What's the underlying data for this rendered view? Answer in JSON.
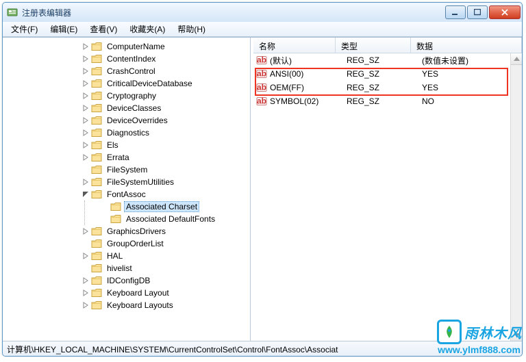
{
  "window": {
    "title": "注册表编辑器"
  },
  "menu": {
    "file": "文件(F)",
    "edit": "编辑(E)",
    "view": "查看(V)",
    "favorites": "收藏夹(A)",
    "help": "帮助(H)"
  },
  "tree": {
    "items": [
      {
        "label": "ComputerName",
        "expandable": true
      },
      {
        "label": "ContentIndex",
        "expandable": true
      },
      {
        "label": "CrashControl",
        "expandable": true
      },
      {
        "label": "CriticalDeviceDatabase",
        "expandable": true
      },
      {
        "label": "Cryptography",
        "expandable": true
      },
      {
        "label": "DeviceClasses",
        "expandable": true
      },
      {
        "label": "DeviceOverrides",
        "expandable": true
      },
      {
        "label": "Diagnostics",
        "expandable": true
      },
      {
        "label": "Els",
        "expandable": true
      },
      {
        "label": "Errata",
        "expandable": true
      },
      {
        "label": "FileSystem",
        "expandable": false
      },
      {
        "label": "FileSystemUtilities",
        "expandable": true
      },
      {
        "label": "FontAssoc",
        "expandable": true,
        "expanded": true,
        "children": [
          {
            "label": "Associated Charset",
            "expandable": false,
            "selected": true
          },
          {
            "label": "Associated DefaultFonts",
            "expandable": false
          }
        ]
      },
      {
        "label": "GraphicsDrivers",
        "expandable": true
      },
      {
        "label": "GroupOrderList",
        "expandable": false
      },
      {
        "label": "HAL",
        "expandable": true
      },
      {
        "label": "hivelist",
        "expandable": false
      },
      {
        "label": "IDConfigDB",
        "expandable": true
      },
      {
        "label": "Keyboard Layout",
        "expandable": true
      },
      {
        "label": "Keyboard Layouts",
        "expandable": true
      }
    ]
  },
  "list": {
    "headers": {
      "name": "名称",
      "type": "类型",
      "data": "数据"
    },
    "rows": [
      {
        "name": "(默认)",
        "type": "REG_SZ",
        "data": "(数值未设置)"
      },
      {
        "name": "ANSI(00)",
        "type": "REG_SZ",
        "data": "YES"
      },
      {
        "name": "OEM(FF)",
        "type": "REG_SZ",
        "data": "YES"
      },
      {
        "name": "SYMBOL(02)",
        "type": "REG_SZ",
        "data": "NO"
      }
    ]
  },
  "statusbar": {
    "path": "计算机\\HKEY_LOCAL_MACHINE\\SYSTEM\\CurrentControlSet\\Control\\FontAssoc\\Associat"
  },
  "watermark": {
    "brand": "雨林木风",
    "url": "www.ylmf888.com"
  }
}
